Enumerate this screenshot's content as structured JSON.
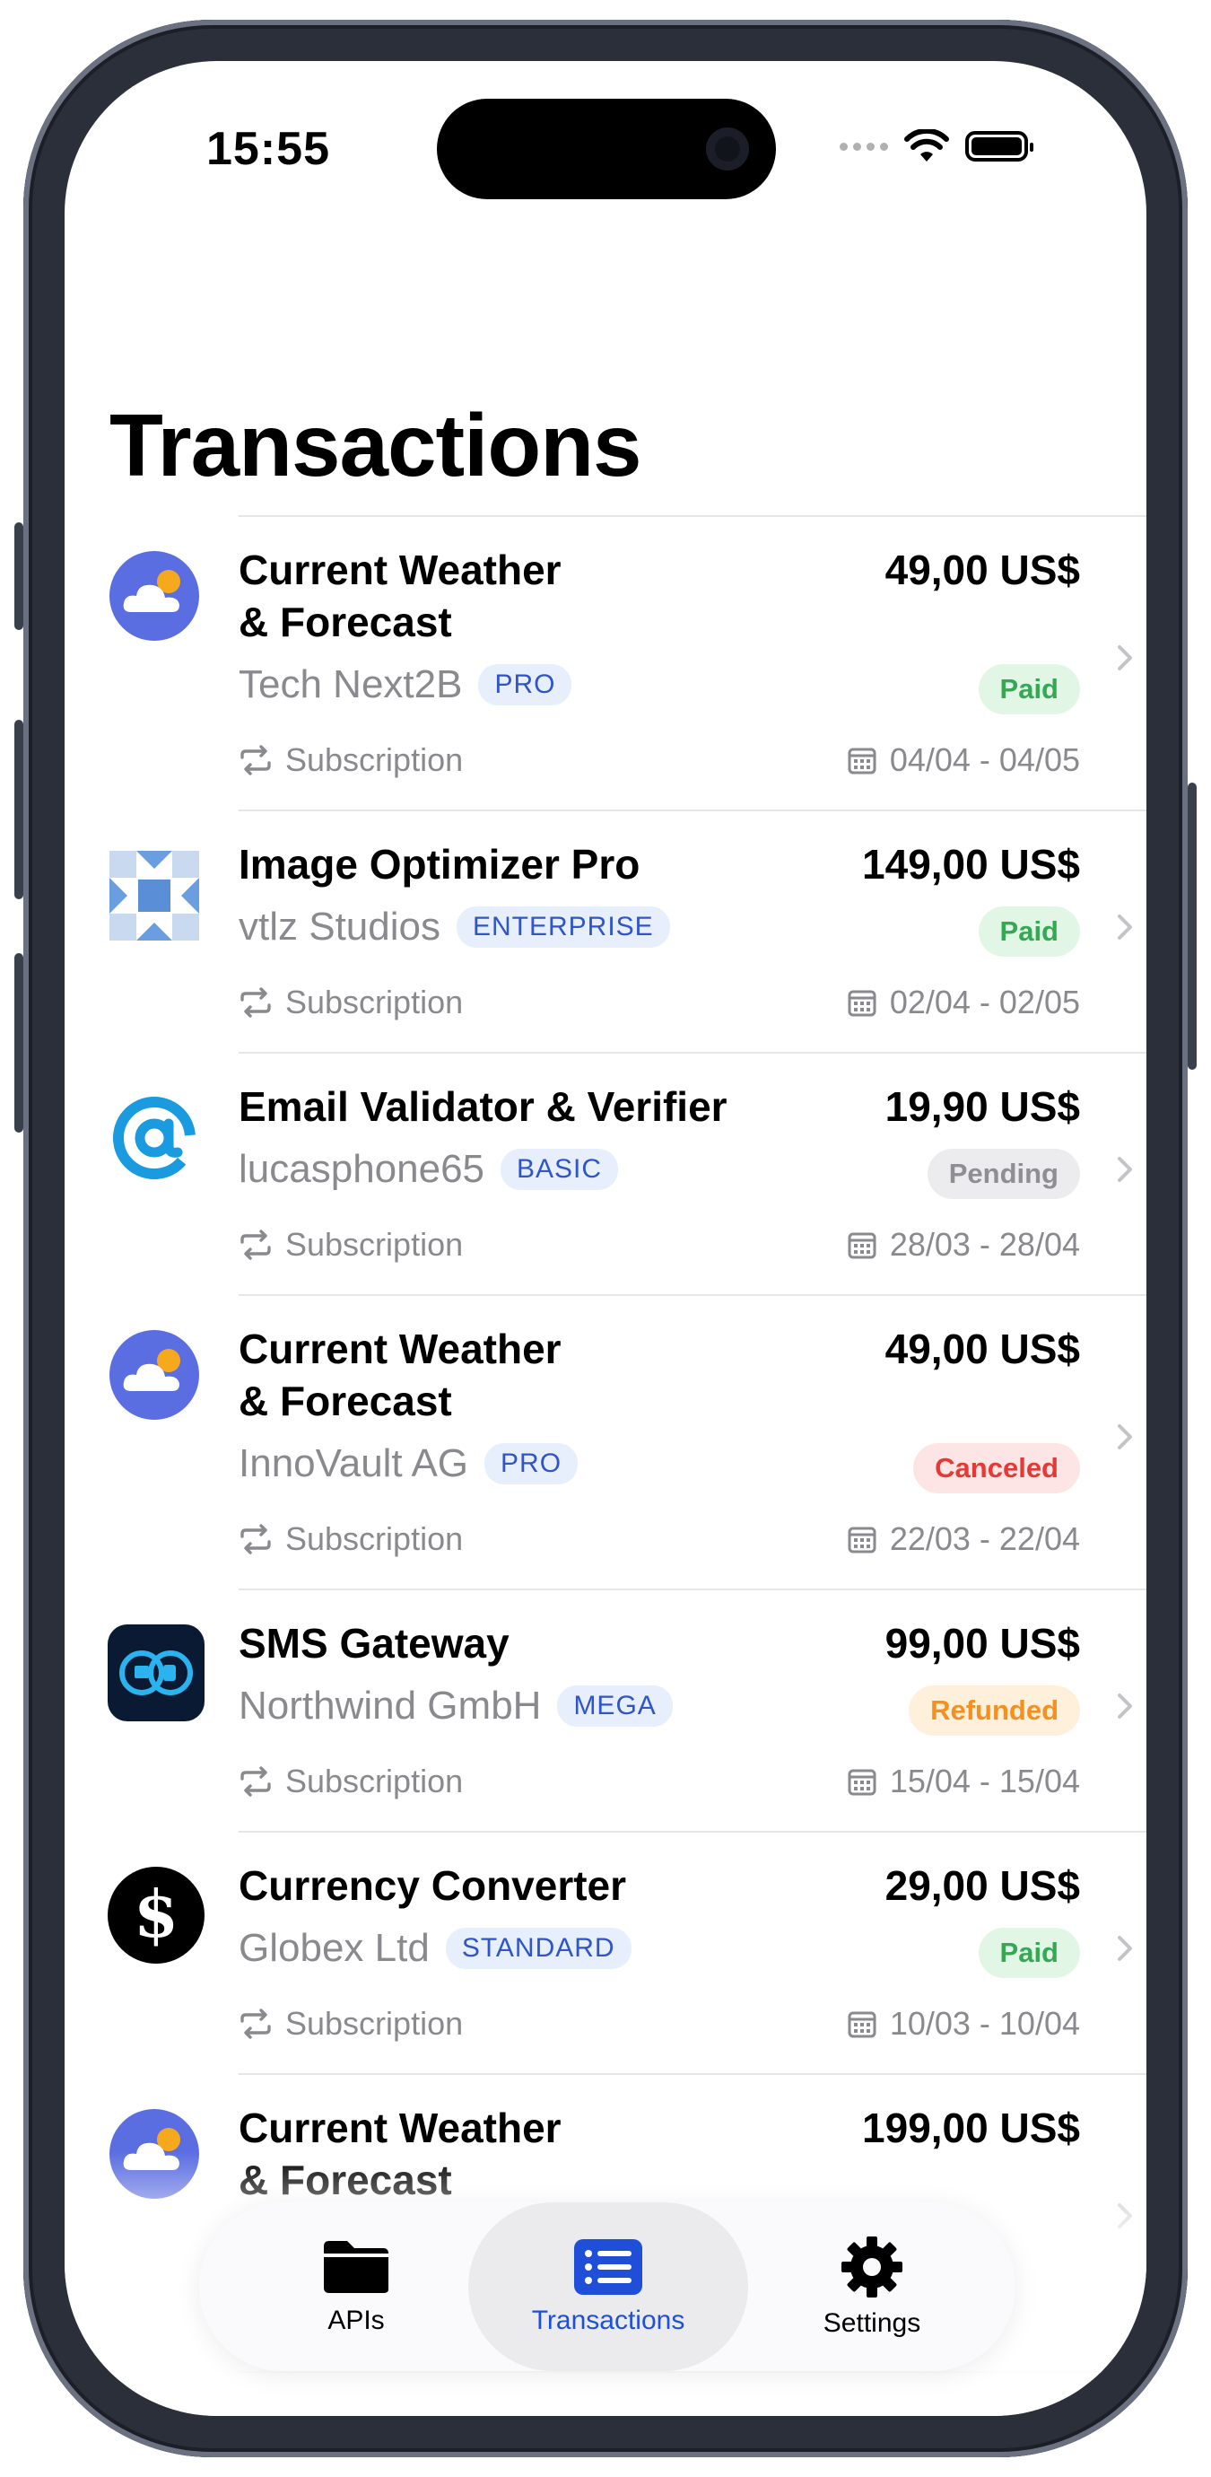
{
  "status_bar": {
    "time": "15:55"
  },
  "page": {
    "title": "Transactions"
  },
  "transactions": [
    {
      "icon": "weather-cloud-icon",
      "name": "Current Weather\n& Forecast",
      "price": "49,00 US$",
      "company": "Tech Next2B",
      "tier": "PRO",
      "status": "Paid",
      "type": "Subscription",
      "period": "04/04 - 04/05"
    },
    {
      "icon": "image-optimizer-icon",
      "name": "Image Optimizer Pro",
      "price": "149,00 US$",
      "company": "vtlz Studios",
      "tier": "ENTERPRISE",
      "status": "Paid",
      "type": "Subscription",
      "period": "02/04 - 02/05"
    },
    {
      "icon": "at-sign-icon",
      "name": "Email Validator & Verifier",
      "price": "19,90 US$",
      "company": "lucasphone65",
      "tier": "BASIC",
      "status": "Pending",
      "type": "Subscription",
      "period": "28/03 - 28/04"
    },
    {
      "icon": "weather-cloud-icon",
      "name": "Current Weather\n& Forecast",
      "price": "49,00 US$",
      "company": "InnoVault AG",
      "tier": "PRO",
      "status": "Canceled",
      "type": "Subscription",
      "period": "22/03 - 22/04"
    },
    {
      "icon": "sms-gateway-icon",
      "name": "SMS Gateway",
      "price": "99,00 US$",
      "company": "Northwind GmbH",
      "tier": "MEGA",
      "status": "Refunded",
      "type": "Subscription",
      "period": "15/04 - 15/04"
    },
    {
      "icon": "dollar-icon",
      "name": "Currency Converter",
      "price": "29,00 US$",
      "company": "Globex Ltd",
      "tier": "STANDARD",
      "status": "Paid",
      "type": "Subscription",
      "period": "10/03 - 10/04"
    },
    {
      "icon": "weather-cloud-icon",
      "name": "Current Weather\n& Forecast",
      "price": "199,00 US$",
      "company": "",
      "tier": "",
      "status": "",
      "type": "",
      "period": ""
    }
  ],
  "tabbar": {
    "tabs": [
      {
        "label": "APIs",
        "icon": "folder-icon"
      },
      {
        "label": "Transactions",
        "icon": "list-icon",
        "active": true
      },
      {
        "label": "Settings",
        "icon": "gear-icon"
      }
    ]
  },
  "colors": {
    "accent": "#1f4fd8",
    "paid": "#34a853",
    "pending": "#8e8e93",
    "canceled": "#e53935",
    "refunded": "#f5901e"
  }
}
